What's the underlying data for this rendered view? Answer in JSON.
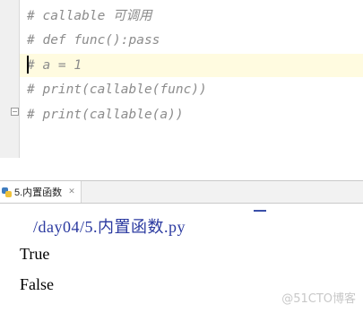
{
  "editor": {
    "lines": [
      "# callable 可调用",
      "# def func():pass",
      "# a = 1",
      "# print(callable(func))",
      "# print(callable(a))"
    ]
  },
  "run_tab": {
    "label": "5.内置函数",
    "close_glyph": "✕"
  },
  "console": {
    "path_text": "/day04/5.内置函数.py",
    "output": [
      "True",
      "False"
    ]
  },
  "watermark": "@51CTO博客",
  "colors": {
    "comment": "#8c8c8c",
    "path": "#2b3aa0",
    "current_line": "#fffbe0"
  }
}
